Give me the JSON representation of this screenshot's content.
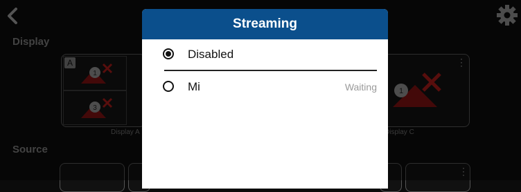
{
  "background": {
    "display_label": "Display",
    "source_label": "Source",
    "panel_a_badge": "A",
    "display_a_caption": "Display A",
    "display_c_caption": "Display C",
    "thumb_numbers": [
      "1",
      "3",
      "1"
    ]
  },
  "dialog": {
    "title": "Streaming",
    "options": [
      {
        "label": "Disabled",
        "status": "",
        "selected": true
      },
      {
        "label": "Mi",
        "status": "Waiting",
        "selected": false
      }
    ]
  },
  "colors": {
    "header": "#0b4f8c",
    "accent_red": "#b3201e"
  }
}
